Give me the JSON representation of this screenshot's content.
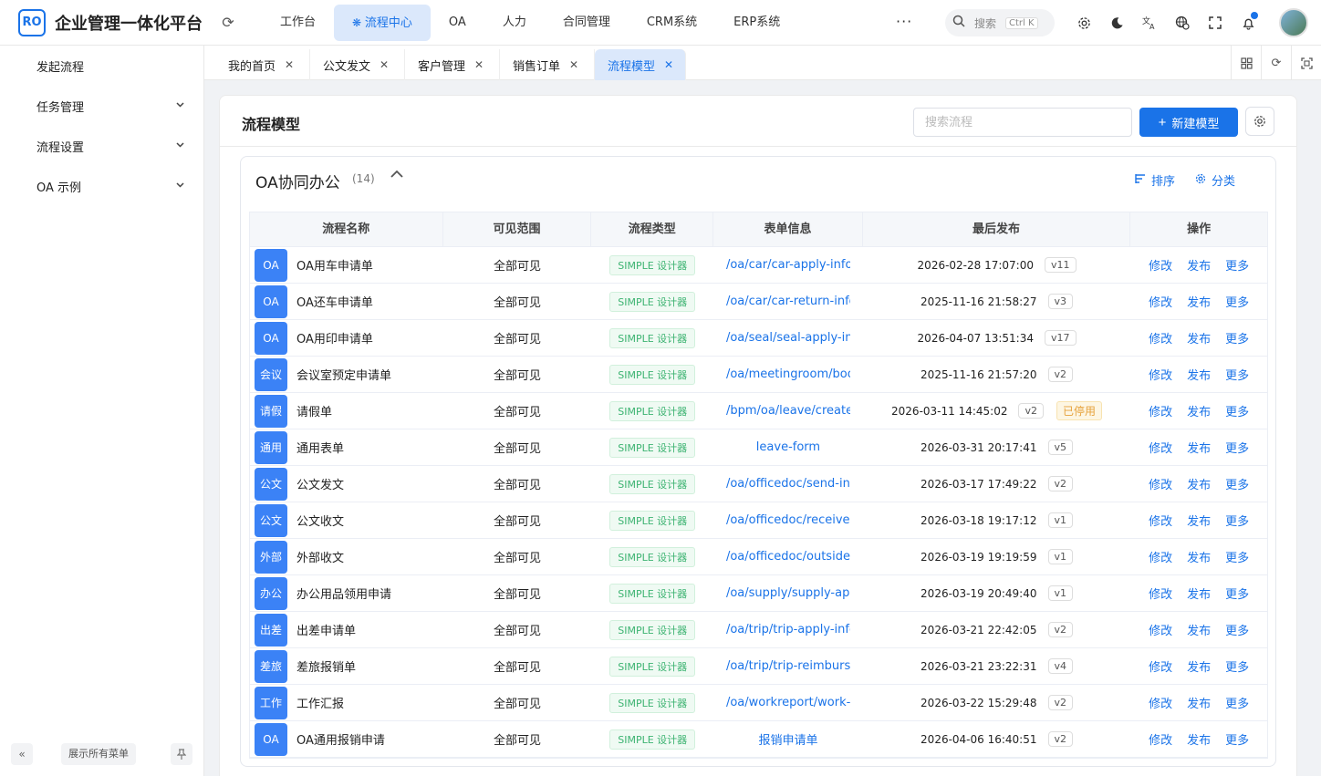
{
  "app": {
    "logo_text": "RO",
    "title": "企业管理一体化平台"
  },
  "topnav": {
    "items": [
      "工作台",
      "流程中心",
      "OA",
      "人力",
      "合同管理",
      "CRM系统",
      "ERP系统"
    ],
    "active": "流程中心",
    "more": "···"
  },
  "search": {
    "label": "搜索",
    "shortcut": "Ctrl K"
  },
  "sidebar": {
    "items": [
      {
        "label": "发起流程",
        "expandable": false
      },
      {
        "label": "任务管理",
        "expandable": true
      },
      {
        "label": "流程设置",
        "expandable": true
      },
      {
        "label": "OA 示例",
        "expandable": true
      }
    ],
    "show_all_label": "展示所有菜单"
  },
  "tabs": [
    {
      "label": "我的首页",
      "active": false
    },
    {
      "label": "公文发文",
      "active": false
    },
    {
      "label": "客户管理",
      "active": false
    },
    {
      "label": "销售订单",
      "active": false
    },
    {
      "label": "流程模型",
      "active": true
    }
  ],
  "page": {
    "title": "流程模型",
    "search_placeholder": "搜索流程",
    "new_button": "新建模型"
  },
  "group": {
    "title": "OA协同办公",
    "count": "(14)",
    "sort_label": "排序",
    "category_label": "分类"
  },
  "table": {
    "headers": [
      "流程名称",
      "可见范围",
      "流程类型",
      "表单信息",
      "最后发布",
      "操作"
    ],
    "actions": [
      "修改",
      "发布",
      "更多"
    ],
    "rows": [
      {
        "icon": "OA",
        "name": "OA用车申请单",
        "scope": "全部可见",
        "type": "SIMPLE 设计器",
        "form": "/oa/car/car-apply-info",
        "published": "2026-02-28 17:07:00",
        "version": "v11",
        "status": ""
      },
      {
        "icon": "OA",
        "name": "OA还车申请单",
        "scope": "全部可见",
        "type": "SIMPLE 设计器",
        "form": "/oa/car/car-return-info",
        "published": "2025-11-16 21:58:27",
        "version": "v3",
        "status": ""
      },
      {
        "icon": "OA",
        "name": "OA用印申请单",
        "scope": "全部可见",
        "type": "SIMPLE 设计器",
        "form": "/oa/seal/seal-apply-info",
        "published": "2026-04-07 13:51:34",
        "version": "v17",
        "status": ""
      },
      {
        "icon": "会议",
        "name": "会议室预定申请单",
        "scope": "全部可见",
        "type": "SIMPLE 设计器",
        "form": "/oa/meetingroom/book",
        "published": "2025-11-16 21:57:20",
        "version": "v2",
        "status": ""
      },
      {
        "icon": "请假",
        "name": "请假单",
        "scope": "全部可见",
        "type": "SIMPLE 设计器",
        "form": "/bpm/oa/leave/create",
        "published": "2026-03-11 14:45:02",
        "version": "v2",
        "status": "已停用"
      },
      {
        "icon": "通用",
        "name": "通用表单",
        "scope": "全部可见",
        "type": "SIMPLE 设计器",
        "form": "leave-form",
        "published": "2026-03-31 20:17:41",
        "version": "v5",
        "status": ""
      },
      {
        "icon": "公文",
        "name": "公文发文",
        "scope": "全部可见",
        "type": "SIMPLE 设计器",
        "form": "/oa/officedoc/send-info",
        "published": "2026-03-17 17:49:22",
        "version": "v2",
        "status": ""
      },
      {
        "icon": "公文",
        "name": "公文收文",
        "scope": "全部可见",
        "type": "SIMPLE 设计器",
        "form": "/oa/officedoc/receive-info",
        "published": "2026-03-18 19:17:12",
        "version": "v1",
        "status": ""
      },
      {
        "icon": "外部",
        "name": "外部收文",
        "scope": "全部可见",
        "type": "SIMPLE 设计器",
        "form": "/oa/officedoc/outside-info",
        "published": "2026-03-19 19:19:59",
        "version": "v1",
        "status": ""
      },
      {
        "icon": "办公",
        "name": "办公用品领用申请",
        "scope": "全部可见",
        "type": "SIMPLE 设计器",
        "form": "/oa/supply/supply-apply",
        "published": "2026-03-19 20:49:40",
        "version": "v1",
        "status": ""
      },
      {
        "icon": "出差",
        "name": "出差申请单",
        "scope": "全部可见",
        "type": "SIMPLE 设计器",
        "form": "/oa/trip/trip-apply-info",
        "published": "2026-03-21 22:42:05",
        "version": "v2",
        "status": ""
      },
      {
        "icon": "差旅",
        "name": "差旅报销单",
        "scope": "全部可见",
        "type": "SIMPLE 设计器",
        "form": "/oa/trip/trip-reimburse",
        "published": "2026-03-21 23:22:31",
        "version": "v4",
        "status": ""
      },
      {
        "icon": "工作",
        "name": "工作汇报",
        "scope": "全部可见",
        "type": "SIMPLE 设计器",
        "form": "/oa/workreport/work-report",
        "published": "2026-03-22 15:29:48",
        "version": "v2",
        "status": ""
      },
      {
        "icon": "OA",
        "name": "OA通用报销申请",
        "scope": "全部可见",
        "type": "SIMPLE 设计器",
        "form": "报销申请单",
        "published": "2026-04-06 16:40:51",
        "version": "v2",
        "status": ""
      }
    ]
  },
  "colors": {
    "primary": "#1a73e8",
    "icon_bg": "#3b82f6",
    "tag_green": "#3cb371",
    "tag_warning": "#e6a23c"
  }
}
